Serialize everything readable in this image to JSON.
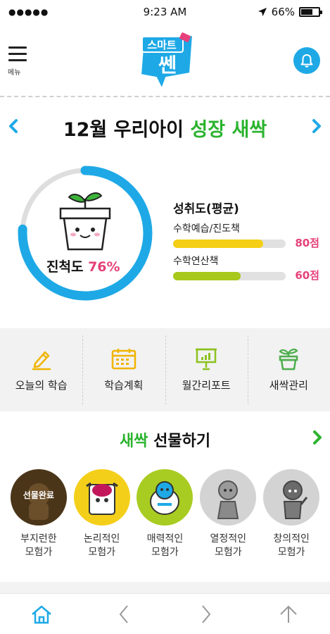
{
  "status": {
    "carrier_dots": "●●●●●",
    "time": "9:23 AM",
    "battery": "66%",
    "battery_level": 0.66
  },
  "header": {
    "menu_label": "메뉴",
    "logo_text_top": "스마트",
    "logo_text_main": "쎈"
  },
  "title": {
    "month": "12월 우리아이",
    "highlight": "성장 새싹"
  },
  "progress": {
    "label": "진척도",
    "value_text": "76%",
    "value": 0.76
  },
  "achievement": {
    "title": "성취도(평균)",
    "items": [
      {
        "name": "수학예습/진도책",
        "score_text": "80점",
        "value": 0.8,
        "color": "#f5cf15"
      },
      {
        "name": "수학연산책",
        "score_text": "60점",
        "value": 0.6,
        "color": "#a8c81b"
      }
    ]
  },
  "menu": [
    {
      "label": "오늘의 학습",
      "icon": "pencil-icon"
    },
    {
      "label": "학습계획",
      "icon": "calendar-icon"
    },
    {
      "label": "월간리포트",
      "icon": "report-board-icon"
    },
    {
      "label": "새싹관리",
      "icon": "sprout-pot-icon"
    }
  ],
  "gift": {
    "title_green": "새싹",
    "title_rest": "선물하기",
    "completed_badge": "선물완료",
    "characters": [
      {
        "line1": "부지런한",
        "line2": "모험가",
        "bg": "#4a3519"
      },
      {
        "line1": "논리적인",
        "line2": "모험가",
        "bg": "#f4cf1a"
      },
      {
        "line1": "매력적인",
        "line2": "모험가",
        "bg": "#a9cc22"
      },
      {
        "line1": "열정적인",
        "line2": "모험가",
        "bg": "#d3d3d3"
      },
      {
        "line1": "창의적인",
        "line2": "모험가",
        "bg": "#d3d3d3"
      }
    ]
  },
  "colors": {
    "accent_blue": "#1ea9e6",
    "accent_green": "#2bb32e",
    "score_pink": "#e6417a"
  }
}
